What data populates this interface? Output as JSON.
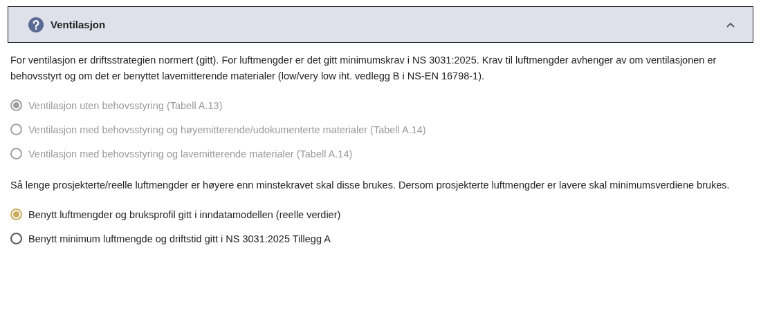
{
  "section": {
    "title": "Ventilasjon",
    "expanded": true
  },
  "intro": "For ventilasjon er driftsstrategien normert (gitt). For luftmengder er det gitt minimumskrav i NS 3031:2025. Krav til luftmengder avhenger av om ventilasjonen er behovsstyrt og om det er benyttet lavemitterende materialer (low/very low iht. vedlegg B i NS-EN 16798-1).",
  "ventilation_options": {
    "disabled": true,
    "options": [
      {
        "label": "Ventilasjon uten behovsstyring (Tabell A.13)",
        "selected": true
      },
      {
        "label": "Ventilasjon med behovsstyring og høyemitterende/udokumenterte materialer (Tabell A.14)",
        "selected": false
      },
      {
        "label": "Ventilasjon med behovsstyring og lavemitterende materialer (Tabell A.14)",
        "selected": false
      }
    ]
  },
  "note": "Så lenge prosjekterte/reelle luftmengder er høyere enn minstekravet skal disse brukes. Dersom prosjekterte luftmengder er lavere skal minimumsverdiene brukes.",
  "airflow_options": {
    "disabled": false,
    "options": [
      {
        "label": "Benytt luftmengder og bruksprofil gitt i inndatamodellen (reelle verdier)",
        "selected": true
      },
      {
        "label": "Benytt minimum luftmengde og driftstid gitt i NS 3031:2025 Tillegg A",
        "selected": false
      }
    ]
  }
}
